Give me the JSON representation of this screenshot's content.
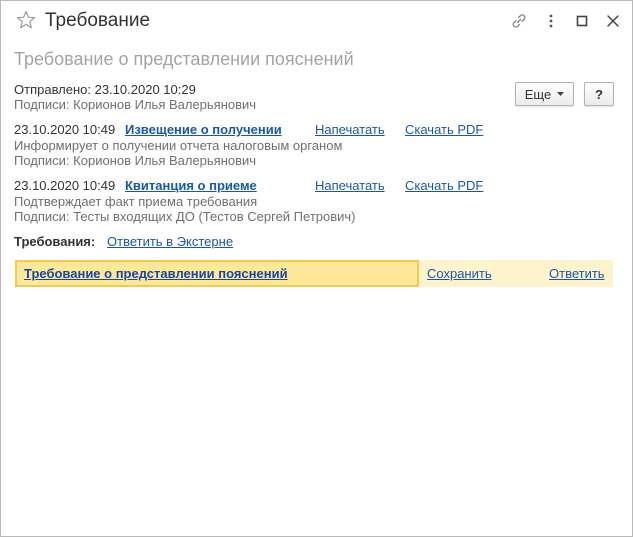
{
  "window": {
    "title": "Требование",
    "subtitle": "Требование о представлении пояснений"
  },
  "icons": {
    "star": "star-icon",
    "link": "link-icon",
    "more": "more-vertical-icon",
    "maximize": "maximize-icon",
    "close": "close-icon",
    "dropdown": "chevron-down-icon"
  },
  "sent": {
    "label": "Отправлено: 23.10.2020 10:29",
    "signatures": "Подписи: Корионов  Илья Валерьянович"
  },
  "toolbar": {
    "more_label": "Еще",
    "help_label": "?"
  },
  "documents": [
    {
      "datetime": "23.10.2020 10:49",
      "title": "Извещение о получении",
      "print": "Напечатать",
      "download": "Скачать PDF",
      "description": "Информирует о получении отчета налоговым органом",
      "signatures": "Подписи: Корионов  Илья Валерьянович"
    },
    {
      "datetime": "23.10.2020 10:49",
      "title": "Квитанция о приеме",
      "print": "Напечатать",
      "download": "Скачать PDF",
      "description": "Подтверждает факт приема требования",
      "signatures": "Подписи: Тесты входящих ДО (Тестов Сергей Петрович)"
    }
  ],
  "requirements": {
    "label": "Требования:",
    "reply_external": "Ответить в Экстерне",
    "item": {
      "title": "Требование о представлении пояснений",
      "save": "Сохранить",
      "reply": "Ответить"
    }
  },
  "colors": {
    "link": "#1b57a8",
    "highlight": "#fde89a",
    "highlight_border": "#f3c94f",
    "row_background": "#fdf3cc"
  }
}
